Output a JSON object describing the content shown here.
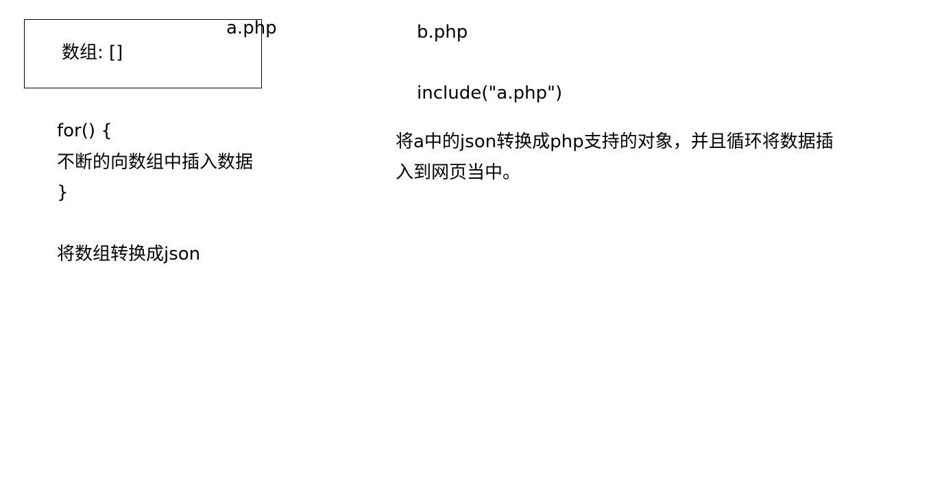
{
  "a_php": {
    "title": "a.php",
    "array_label": "数组: []",
    "loop_open": "for() {",
    "loop_body": "不断的向数组中插入数据",
    "loop_close": "}",
    "to_json": "将数组转换成json"
  },
  "b_php": {
    "title": "b.php",
    "include": "include(\"a.php\")",
    "description_line1": "将a中的json转换成php支持的对象，并且循环将数据插",
    "description_line2": "入到网页当中。"
  },
  "colors": {
    "text": "#000000",
    "border": "#000000",
    "background": "#ffffff"
  }
}
